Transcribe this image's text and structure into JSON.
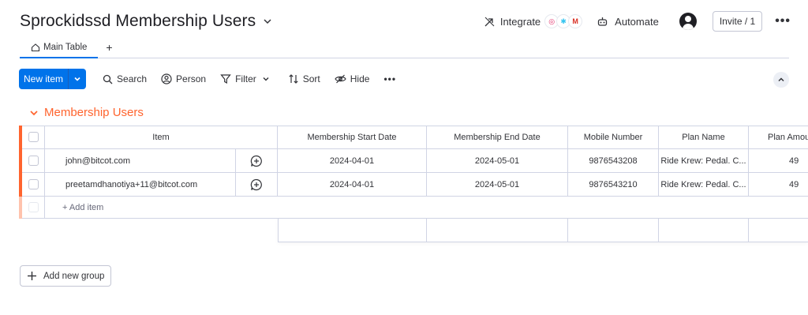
{
  "header": {
    "board_title": "Sprockidssd Membership Users",
    "integrate_label": "Integrate",
    "automate_label": "Automate",
    "invite_label": "Invite / 1",
    "more_label": "•••"
  },
  "tabs": [
    {
      "label": "Main Table",
      "active": true
    }
  ],
  "tab_add_label": "+",
  "toolbar": {
    "new_item_label": "New item",
    "search_label": "Search",
    "person_label": "Person",
    "filter_label": "Filter",
    "sort_label": "Sort",
    "hide_label": "Hide",
    "more_label": "•••"
  },
  "group": {
    "title": "Membership Users",
    "color": "#ff642e",
    "columns": [
      "Item",
      "Membership Start Date",
      "Membership End Date",
      "Mobile Number",
      "Plan Name",
      "Plan Amou"
    ],
    "rows": [
      {
        "item": "john@bitcot.com",
        "start": "2024-04-01",
        "end": "2024-05-01",
        "mobile": "9876543208",
        "plan": "Ride Krew: Pedal. C...",
        "amount": "49"
      },
      {
        "item": "preetamdhanotiya+11@bitcot.com",
        "start": "2024-04-01",
        "end": "2024-05-01",
        "mobile": "9876543210",
        "plan": "Ride Krew: Pedal. C...",
        "amount": "49"
      }
    ],
    "add_item_label": "+ Add item"
  },
  "add_group_label": "Add new group",
  "colors": {
    "accent": "#0073ea",
    "group": "#ff642e"
  }
}
